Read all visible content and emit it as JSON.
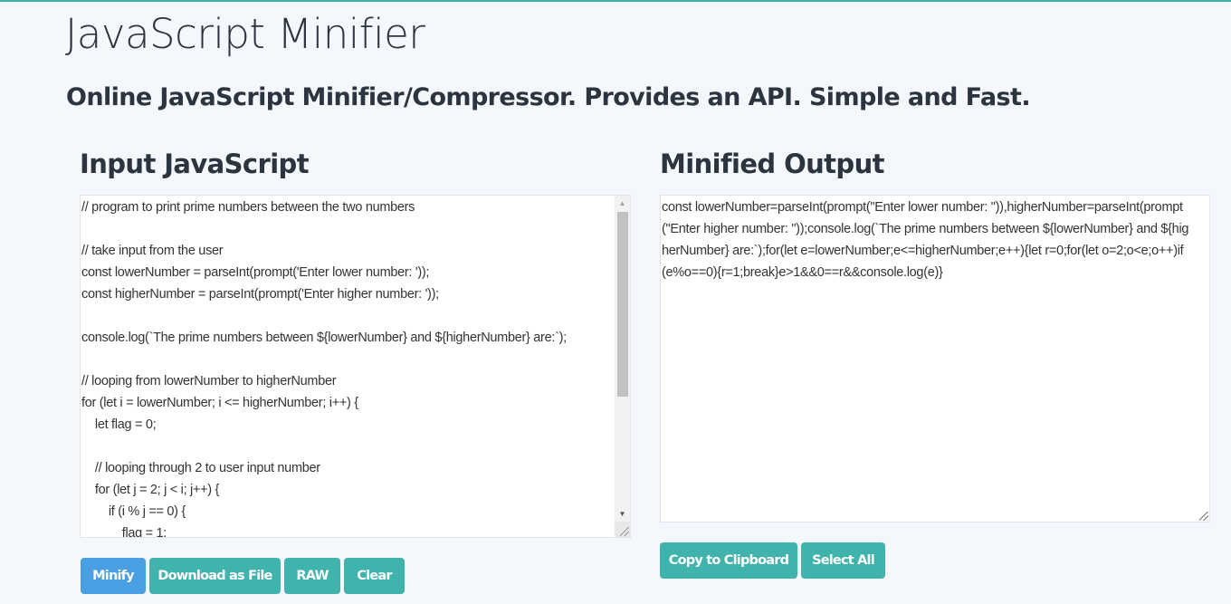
{
  "header": {
    "title": "JavaScript Minifier",
    "subtitle": "Online JavaScript Minifier/Compressor. Provides an API. Simple and Fast."
  },
  "input": {
    "heading": "Input JavaScript",
    "code": "// program to print prime numbers between the two numbers\n\n// take input from the user\nconst lowerNumber = parseInt(prompt('Enter lower number: '));\nconst higherNumber = parseInt(prompt('Enter higher number: '));\n\nconsole.log(`The prime numbers between ${lowerNumber} and ${higherNumber} are:`);\n\n// looping from lowerNumber to higherNumber\nfor (let i = lowerNumber; i <= higherNumber; i++) {\n    let flag = 0;\n\n    // looping through 2 to user input number\n    for (let j = 2; j < i; j++) {\n        if (i % j == 0) {\n            flag = 1;",
    "scroll_up_icon": "▲",
    "scroll_down_icon": "▼",
    "buttons": {
      "minify": "Minify",
      "download": "Download as File",
      "raw": "RAW",
      "clear": "Clear"
    }
  },
  "output": {
    "heading": "Minified Output",
    "code": "const lowerNumber=parseInt(prompt(\"Enter lower number: \")),higherNumber=parseInt(prompt(\"Enter higher number: \"));console.log(`The prime numbers between ${lowerNumber} and ${higherNumber} are:`);for(let e=lowerNumber;e<=higherNumber;e++){let r=0;for(let o=2;o<e;o++)if(e%o==0){r=1;break}e>1&&0==r&&console.log(e)}",
    "buttons": {
      "copy": "Copy to Clipboard",
      "select_all": "Select All"
    }
  },
  "colors": {
    "accent_teal": "#40b3ac",
    "primary_blue": "#4a9ee2",
    "background": "#f4f7fb",
    "text": "#2c3440"
  }
}
